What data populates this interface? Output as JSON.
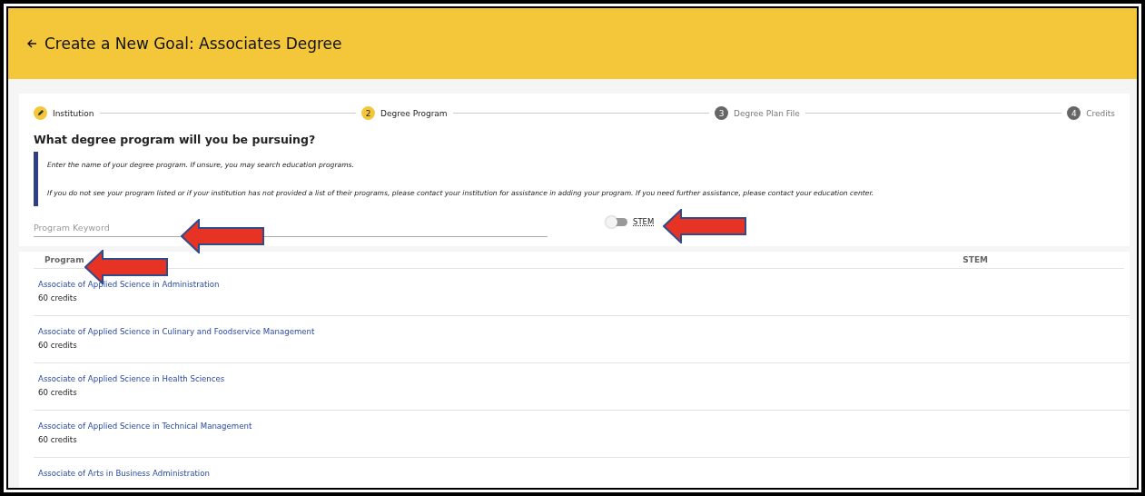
{
  "header": {
    "title": "Create a New Goal: Associates Degree"
  },
  "steps": [
    {
      "label": "Institution",
      "kind": "done"
    },
    {
      "number": "2",
      "label": "Degree Program",
      "kind": "current"
    },
    {
      "number": "3",
      "label": "Degree Plan File",
      "kind": "upcoming"
    },
    {
      "number": "4",
      "label": "Credits",
      "kind": "upcoming"
    }
  ],
  "question": "What degree program will you be pursuing?",
  "info": [
    "Enter the name of your degree program. If unsure, you may search education programs.",
    "If you do not see your program listed or if your institution has not provided a list of their programs, please contact your institution for assistance in adding your program. If you need further assistance, please contact your education center."
  ],
  "search": {
    "placeholder": "Program Keyword"
  },
  "stem_toggle": {
    "label": "STEM",
    "on": false
  },
  "table": {
    "columns": [
      "Program",
      "STEM"
    ],
    "rows": [
      {
        "program": "Associate of Applied Science in Administration",
        "credits": "60 credits"
      },
      {
        "program": "Associate of Applied Science in Culinary and Foodservice Management",
        "credits": "60 credits"
      },
      {
        "program": "Associate of Applied Science in Health Sciences",
        "credits": "60 credits"
      },
      {
        "program": "Associate of Applied Science in Technical Management",
        "credits": "60 credits"
      },
      {
        "program": "Associate of Arts in Business Administration"
      }
    ]
  }
}
